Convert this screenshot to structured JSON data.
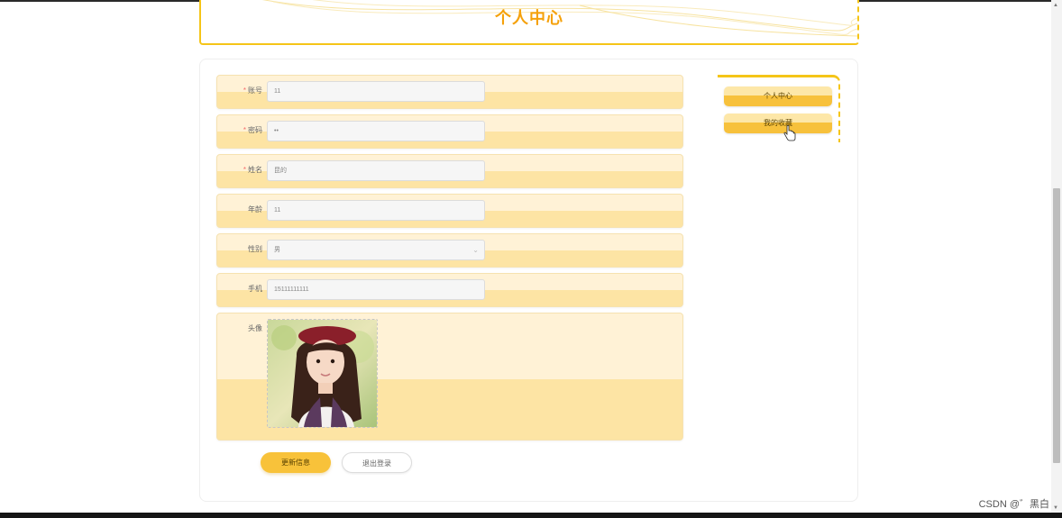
{
  "header": {
    "title": "个人中心"
  },
  "form": {
    "fields": [
      {
        "label": "账号",
        "required": true,
        "value": "11"
      },
      {
        "label": "密码",
        "required": true,
        "value": "••"
      },
      {
        "label": "姓名",
        "required": true,
        "value": "昆的"
      },
      {
        "label": "年龄",
        "required": false,
        "value": "11"
      },
      {
        "label": "性别",
        "required": false,
        "value": "男",
        "chevron": "⌄"
      },
      {
        "label": "手机",
        "required": false,
        "value": "15111111111"
      }
    ],
    "avatar": {
      "label": "头像",
      "icon": "avatar-photo"
    },
    "required_mark": "*"
  },
  "buttons": {
    "update": "更新信息",
    "logout": "退出登录"
  },
  "side_menu": {
    "items": [
      "个人中心",
      "我的收藏"
    ]
  },
  "scrollbar": {
    "up": "▲",
    "down": "▼"
  },
  "watermark": "CSDN @゛黑白",
  "colors": {
    "accent": "#f5c518",
    "title": "#f5a10a",
    "row_light": "#fff2d6",
    "row_dark": "#fde4a4"
  }
}
